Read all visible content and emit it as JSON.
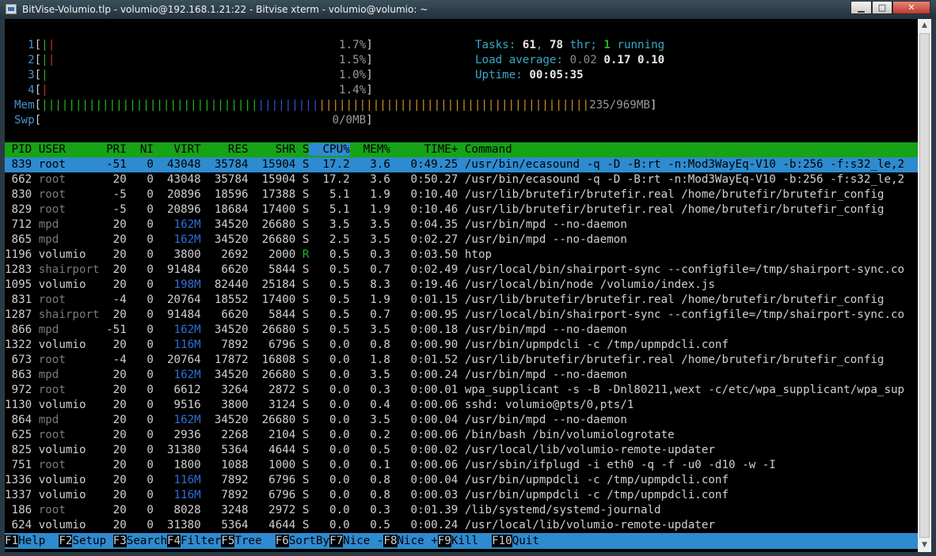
{
  "window": {
    "title": "BitVise-Volumio.tlp - volumio@192.168.1.21:22 - Bitvise xterm - volumio@volumio: ~",
    "min_glyph": "▁",
    "max_glyph": "□",
    "close_glyph": "✕"
  },
  "meters": {
    "cpus": [
      {
        "num": "1",
        "bars": [
          [
            "g",
            "|"
          ],
          [
            "r",
            "|"
          ]
        ],
        "value": "1.7%"
      },
      {
        "num": "2",
        "bars": [
          [
            "g",
            "|"
          ],
          [
            "r",
            "|"
          ]
        ],
        "value": "1.5%"
      },
      {
        "num": "3",
        "bars": [
          [
            "g",
            "|"
          ]
        ],
        "value": "1.0%"
      },
      {
        "num": "4",
        "bars": [
          [
            "r",
            "|"
          ]
        ],
        "value": "1.4%"
      }
    ],
    "mem": {
      "label": "Mem",
      "bars": [
        [
          "g",
          "||||||||||||||||||||||||||||||||"
        ],
        [
          "b",
          "|||||||||"
        ],
        [
          "o",
          "||||||||||||||||||||||||||||||||||||||||"
        ]
      ],
      "value": "235/969MB"
    },
    "swp": {
      "label": "Swp",
      "bars": [],
      "value": "0/0MB"
    }
  },
  "summary": {
    "tasks_label": "Tasks: ",
    "tasks": "61",
    "thr_sep": ", ",
    "threads": "78",
    "thr_label": " thr; ",
    "running": "1",
    "running_label": " running",
    "load_label": "Load average: ",
    "load1": "0.02",
    "load5": "0.17",
    "load15": "0.10",
    "uptime_label": "Uptime: ",
    "uptime": "00:05:35"
  },
  "columns": [
    "PID",
    "USER",
    "PRI",
    "NI",
    "VIRT",
    "RES",
    "SHR",
    "S",
    "CPU%",
    "MEM%",
    "TIME+",
    "Command"
  ],
  "sort_column": "CPU%",
  "processes": [
    {
      "pid": "839",
      "user": "root",
      "pri": "-51",
      "ni": "0",
      "virt": "43048",
      "res": "35784",
      "shr": "15904",
      "s": "S",
      "cpu": "17.2",
      "mem": "3.6",
      "time": "0:49.25",
      "cmd": "/usr/bin/ecasound -q -D -B:rt -n:Mod3WayEq-V10 -b:256 -f:s32_le,2",
      "selected": true
    },
    {
      "pid": "662",
      "user": "root",
      "pri": "20",
      "ni": "0",
      "virt": "43048",
      "res": "35784",
      "shr": "15904",
      "s": "S",
      "cpu": "17.2",
      "mem": "3.6",
      "time": "0:50.27",
      "cmd": "/usr/bin/ecasound -q -D -B:rt -n:Mod3WayEq-V10 -b:256 -f:s32_le,2"
    },
    {
      "pid": "830",
      "user": "root",
      "pri": "-5",
      "ni": "0",
      "virt": "20896",
      "res": "18596",
      "shr": "17388",
      "s": "S",
      "cpu": "5.1",
      "mem": "1.9",
      "time": "0:10.40",
      "cmd": "/usr/lib/brutefir/brutefir.real /home/brutefir/brutefir_config"
    },
    {
      "pid": "829",
      "user": "root",
      "pri": "-5",
      "ni": "0",
      "virt": "20896",
      "res": "18684",
      "shr": "17400",
      "s": "S",
      "cpu": "5.1",
      "mem": "1.9",
      "time": "0:10.46",
      "cmd": "/usr/lib/brutefir/brutefir.real /home/brutefir/brutefir_config"
    },
    {
      "pid": "712",
      "user": "mpd",
      "pri": "20",
      "ni": "0",
      "virt": "162M",
      "res": "34520",
      "shr": "26680",
      "s": "S",
      "cpu": "3.5",
      "mem": "3.5",
      "time": "0:04.35",
      "cmd": "/usr/bin/mpd --no-daemon"
    },
    {
      "pid": "865",
      "user": "mpd",
      "pri": "20",
      "ni": "0",
      "virt": "162M",
      "res": "34520",
      "shr": "26680",
      "s": "S",
      "cpu": "2.5",
      "mem": "3.5",
      "time": "0:02.27",
      "cmd": "/usr/bin/mpd --no-daemon"
    },
    {
      "pid": "1196",
      "user": "volumio",
      "pri": "20",
      "ni": "0",
      "virt": "3800",
      "res": "2692",
      "shr": "2000",
      "s": "R",
      "cpu": "0.5",
      "mem": "0.3",
      "time": "0:03.50",
      "cmd": "htop"
    },
    {
      "pid": "1283",
      "user": "shairport",
      "pri": "20",
      "ni": "0",
      "virt": "91484",
      "res": "6620",
      "shr": "5844",
      "s": "S",
      "cpu": "0.5",
      "mem": "0.7",
      "time": "0:02.49",
      "cmd": "/usr/local/bin/shairport-sync --configfile=/tmp/shairport-sync.co"
    },
    {
      "pid": "1095",
      "user": "volumio",
      "pri": "20",
      "ni": "0",
      "virt": "198M",
      "res": "82440",
      "shr": "25184",
      "s": "S",
      "cpu": "0.5",
      "mem": "8.3",
      "time": "0:19.46",
      "cmd": "/usr/local/bin/node /volumio/index.js"
    },
    {
      "pid": "831",
      "user": "root",
      "pri": "-4",
      "ni": "0",
      "virt": "20764",
      "res": "18552",
      "shr": "17400",
      "s": "S",
      "cpu": "0.5",
      "mem": "1.9",
      "time": "0:01.15",
      "cmd": "/usr/lib/brutefir/brutefir.real /home/brutefir/brutefir_config"
    },
    {
      "pid": "1287",
      "user": "shairport",
      "pri": "20",
      "ni": "0",
      "virt": "91484",
      "res": "6620",
      "shr": "5844",
      "s": "S",
      "cpu": "0.5",
      "mem": "0.7",
      "time": "0:00.95",
      "cmd": "/usr/local/bin/shairport-sync --configfile=/tmp/shairport-sync.co"
    },
    {
      "pid": "866",
      "user": "mpd",
      "pri": "-51",
      "ni": "0",
      "virt": "162M",
      "res": "34520",
      "shr": "26680",
      "s": "S",
      "cpu": "0.5",
      "mem": "3.5",
      "time": "0:00.18",
      "cmd": "/usr/bin/mpd --no-daemon"
    },
    {
      "pid": "1322",
      "user": "volumio",
      "pri": "20",
      "ni": "0",
      "virt": "116M",
      "res": "7892",
      "shr": "6796",
      "s": "S",
      "cpu": "0.0",
      "mem": "0.8",
      "time": "0:00.90",
      "cmd": "/usr/bin/upmpdcli -c /tmp/upmpdcli.conf"
    },
    {
      "pid": "673",
      "user": "root",
      "pri": "-4",
      "ni": "0",
      "virt": "20764",
      "res": "17872",
      "shr": "16808",
      "s": "S",
      "cpu": "0.0",
      "mem": "1.8",
      "time": "0:01.52",
      "cmd": "/usr/lib/brutefir/brutefir.real /home/brutefir/brutefir_config"
    },
    {
      "pid": "863",
      "user": "mpd",
      "pri": "20",
      "ni": "0",
      "virt": "162M",
      "res": "34520",
      "shr": "26680",
      "s": "S",
      "cpu": "0.0",
      "mem": "3.5",
      "time": "0:00.24",
      "cmd": "/usr/bin/mpd --no-daemon"
    },
    {
      "pid": "972",
      "user": "root",
      "pri": "20",
      "ni": "0",
      "virt": "6612",
      "res": "3264",
      "shr": "2872",
      "s": "S",
      "cpu": "0.0",
      "mem": "0.3",
      "time": "0:00.01",
      "cmd": "wpa_supplicant -s -B -Dnl80211,wext -c/etc/wpa_supplicant/wpa_sup"
    },
    {
      "pid": "1130",
      "user": "volumio",
      "pri": "20",
      "ni": "0",
      "virt": "9516",
      "res": "3800",
      "shr": "3124",
      "s": "S",
      "cpu": "0.0",
      "mem": "0.4",
      "time": "0:00.06",
      "cmd": "sshd: volumio@pts/0,pts/1"
    },
    {
      "pid": "864",
      "user": "mpd",
      "pri": "20",
      "ni": "0",
      "virt": "162M",
      "res": "34520",
      "shr": "26680",
      "s": "S",
      "cpu": "0.0",
      "mem": "3.5",
      "time": "0:00.04",
      "cmd": "/usr/bin/mpd --no-daemon"
    },
    {
      "pid": "625",
      "user": "root",
      "pri": "20",
      "ni": "0",
      "virt": "2936",
      "res": "2268",
      "shr": "2104",
      "s": "S",
      "cpu": "0.0",
      "mem": "0.2",
      "time": "0:00.06",
      "cmd": "/bin/bash /bin/volumiologrotate"
    },
    {
      "pid": "825",
      "user": "volumio",
      "pri": "20",
      "ni": "0",
      "virt": "31380",
      "res": "5364",
      "shr": "4644",
      "s": "S",
      "cpu": "0.0",
      "mem": "0.5",
      "time": "0:00.02",
      "cmd": "/usr/local/lib/volumio-remote-updater"
    },
    {
      "pid": "751",
      "user": "root",
      "pri": "20",
      "ni": "0",
      "virt": "1800",
      "res": "1088",
      "shr": "1000",
      "s": "S",
      "cpu": "0.0",
      "mem": "0.1",
      "time": "0:00.06",
      "cmd": "/usr/sbin/ifplugd -i eth0 -q -f -u0 -d10 -w -I"
    },
    {
      "pid": "1336",
      "user": "volumio",
      "pri": "20",
      "ni": "0",
      "virt": "116M",
      "res": "7892",
      "shr": "6796",
      "s": "S",
      "cpu": "0.0",
      "mem": "0.8",
      "time": "0:00.04",
      "cmd": "/usr/bin/upmpdcli -c /tmp/upmpdcli.conf"
    },
    {
      "pid": "1337",
      "user": "volumio",
      "pri": "20",
      "ni": "0",
      "virt": "116M",
      "res": "7892",
      "shr": "6796",
      "s": "S",
      "cpu": "0.0",
      "mem": "0.8",
      "time": "0:00.03",
      "cmd": "/usr/bin/upmpdcli -c /tmp/upmpdcli.conf"
    },
    {
      "pid": "186",
      "user": "root",
      "pri": "20",
      "ni": "0",
      "virt": "8028",
      "res": "3248",
      "shr": "2972",
      "s": "S",
      "cpu": "0.0",
      "mem": "0.3",
      "time": "0:01.39",
      "cmd": "/lib/systemd/systemd-journald"
    },
    {
      "pid": "624",
      "user": "volumio",
      "pri": "20",
      "ni": "0",
      "virt": "31380",
      "res": "5364",
      "shr": "4644",
      "s": "S",
      "cpu": "0.0",
      "mem": "0.5",
      "time": "0:00.24",
      "cmd": "/usr/local/lib/volumio-remote-updater"
    }
  ],
  "function_keys": [
    {
      "key": "F1",
      "label": "Help  "
    },
    {
      "key": "F2",
      "label": "Setup "
    },
    {
      "key": "F3",
      "label": "Search"
    },
    {
      "key": "F4",
      "label": "Filter"
    },
    {
      "key": "F5",
      "label": "Tree  "
    },
    {
      "key": "F6",
      "label": "SortBy"
    },
    {
      "key": "F7",
      "label": "Nice -"
    },
    {
      "key": "F8",
      "label": "Nice +"
    },
    {
      "key": "F9",
      "label": "Kill  "
    },
    {
      "key": "F10",
      "label": "Quit"
    }
  ],
  "colors": {
    "header_bg": "#16a316",
    "selection_bg": "#2e8bd0",
    "meter_label": "#4a90d0",
    "info_label": "#3aa8c8"
  }
}
